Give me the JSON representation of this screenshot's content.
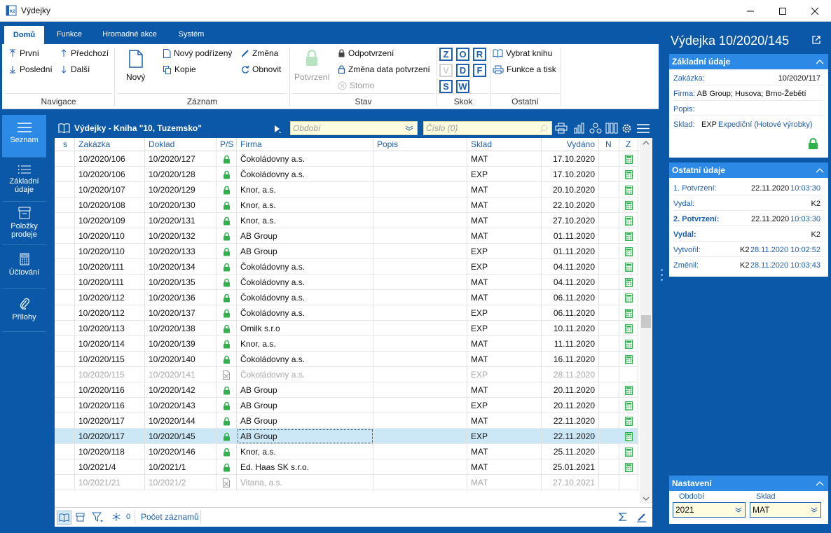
{
  "window": {
    "title": "Výdejky"
  },
  "ribbon": {
    "tabs": [
      "Domů",
      "Funkce",
      "Hromadné akce",
      "Systém"
    ],
    "nav": {
      "first": "První",
      "prev": "Předchozí",
      "last": "Poslední",
      "next": "Další",
      "group": "Navigace"
    },
    "record": {
      "new": "Nový",
      "new_child": "Nový podřízený",
      "change": "Změna",
      "copy": "Kopie",
      "refresh": "Obnovit",
      "group": "Záznam"
    },
    "state": {
      "confirm": "Potvrzení",
      "unconfirm": "Odpotvrzení",
      "change_date": "Změna data potvrzení",
      "storno": "Storno",
      "group": "Stav"
    },
    "jump": {
      "keys": [
        "Z",
        "O",
        "R",
        "V",
        "D",
        "F",
        "S",
        "W"
      ],
      "group": "Skok"
    },
    "other": {
      "select_book": "Vybrat knihu",
      "functions_print": "Funkce a tisk",
      "group": "Ostatní"
    }
  },
  "leftnav": [
    "Seznam",
    "Základní údaje",
    "Položky prodeje",
    "Účtování",
    "Přílohy"
  ],
  "grid": {
    "title": "Výdejky - Kniha \"10, Tuzemsko\"",
    "filter_period_placeholder": "Období",
    "filter_number_placeholder": "Číslo (0)",
    "columns": [
      "s",
      "Zakázka",
      "Doklad",
      "P/S",
      "Firma",
      "Popis",
      "Sklad",
      "Vydáno",
      "N",
      "Z"
    ],
    "rows": [
      {
        "zakazka": "10/2020/106",
        "doklad": "10/2020/127",
        "firma": "Čokoládovny a.s.",
        "sklad": "MAT",
        "vydano": "17.10.2020",
        "state": "locked"
      },
      {
        "zakazka": "10/2020/106",
        "doklad": "10/2020/128",
        "firma": "Čokoládovny a.s.",
        "sklad": "EXP",
        "vydano": "17.10.2020",
        "state": "locked"
      },
      {
        "zakazka": "10/2020/107",
        "doklad": "10/2020/129",
        "firma": "Knor, a.s.",
        "sklad": "MAT",
        "vydano": "20.10.2020",
        "state": "locked"
      },
      {
        "zakazka": "10/2020/108",
        "doklad": "10/2020/130",
        "firma": "Knor, a.s.",
        "sklad": "MAT",
        "vydano": "22.10.2020",
        "state": "locked"
      },
      {
        "zakazka": "10/2020/109",
        "doklad": "10/2020/131",
        "firma": "Knor, a.s.",
        "sklad": "MAT",
        "vydano": "27.10.2020",
        "state": "locked"
      },
      {
        "zakazka": "10/2020/110",
        "doklad": "10/2020/132",
        "firma": "AB Group",
        "sklad": "MAT",
        "vydano": "01.11.2020",
        "state": "locked"
      },
      {
        "zakazka": "10/2020/110",
        "doklad": "10/2020/133",
        "firma": "AB Group",
        "sklad": "EXP",
        "vydano": "01.11.2020",
        "state": "locked"
      },
      {
        "zakazka": "10/2020/111",
        "doklad": "10/2020/134",
        "firma": "Čokoládovny a.s.",
        "sklad": "EXP",
        "vydano": "04.11.2020",
        "state": "locked"
      },
      {
        "zakazka": "10/2020/111",
        "doklad": "10/2020/135",
        "firma": "Čokoládovny a.s.",
        "sklad": "MAT",
        "vydano": "04.11.2020",
        "state": "locked"
      },
      {
        "zakazka": "10/2020/112",
        "doklad": "10/2020/136",
        "firma": "Čokoládovny a.s.",
        "sklad": "MAT",
        "vydano": "06.11.2020",
        "state": "locked"
      },
      {
        "zakazka": "10/2020/112",
        "doklad": "10/2020/137",
        "firma": "Čokoládovny a.s.",
        "sklad": "EXP",
        "vydano": "06.11.2020",
        "state": "locked"
      },
      {
        "zakazka": "10/2020/113",
        "doklad": "10/2020/138",
        "firma": "Omilk s.r.o",
        "sklad": "EXP",
        "vydano": "10.11.2020",
        "state": "locked"
      },
      {
        "zakazka": "10/2020/114",
        "doklad": "10/2020/139",
        "firma": "Knor, a.s.",
        "sklad": "MAT",
        "vydano": "11.11.2020",
        "state": "locked"
      },
      {
        "zakazka": "10/2020/115",
        "doklad": "10/2020/140",
        "firma": "Čokoládovny a.s.",
        "sklad": "MAT",
        "vydano": "16.11.2020",
        "state": "locked"
      },
      {
        "zakazka": "10/2020/115",
        "doklad": "10/2020/141",
        "firma": "Čokoládovny a.s.",
        "sklad": "EXP",
        "vydano": "28.11.2020",
        "state": "storno"
      },
      {
        "zakazka": "10/2020/116",
        "doklad": "10/2020/142",
        "firma": "AB Group",
        "sklad": "MAT",
        "vydano": "20.11.2020",
        "state": "locked"
      },
      {
        "zakazka": "10/2020/116",
        "doklad": "10/2020/143",
        "firma": "AB Group",
        "sklad": "EXP",
        "vydano": "20.11.2020",
        "state": "locked"
      },
      {
        "zakazka": "10/2020/117",
        "doklad": "10/2020/144",
        "firma": "AB Group",
        "sklad": "MAT",
        "vydano": "22.11.2020",
        "state": "locked"
      },
      {
        "zakazka": "10/2020/117",
        "doklad": "10/2020/145",
        "firma": "AB Group",
        "sklad": "EXP",
        "vydano": "22.11.2020",
        "state": "locked",
        "selected": true
      },
      {
        "zakazka": "10/2020/118",
        "doklad": "10/2020/146",
        "firma": "Knor, a.s.",
        "sklad": "MAT",
        "vydano": "25.11.2020",
        "state": "locked"
      },
      {
        "zakazka": "10/2021/4",
        "doklad": "10/2021/1",
        "firma": "Ed. Haas SK s.r.o.",
        "sklad": "MAT",
        "vydano": "25.01.2021",
        "state": "locked"
      },
      {
        "zakazka": "10/2021/21",
        "doklad": "10/2021/2",
        "firma": "Vitana, a.s.",
        "sklad": "MAT",
        "vydano": "27.10.2021",
        "state": "storno"
      }
    ],
    "status": {
      "count": "0",
      "record_count": "Počet záznamů"
    }
  },
  "detail": {
    "title": "Výdejka 10/2020/145",
    "basic": {
      "header": "Základní údaje",
      "zakazka_label": "Zakázka:",
      "zakazka": "10/2020/117",
      "firma_label": "Firma:",
      "firma": "AB Group; Husova; Brno-Žebětí",
      "popis_label": "Popis:",
      "sklad_label": "Sklad:",
      "sklad_code": "EXP",
      "sklad_name": "Expediční (Hotové výrobky)"
    },
    "other": {
      "header": "Ostatní údaje",
      "conf1_label": "1. Potvrzení:",
      "conf1_date": "22.11.2020",
      "conf1_time": "10:03:30",
      "vydal1_label": "Vydal:",
      "vydal1": "K2",
      "conf2_label": "2. Potvrzení:",
      "conf2_date": "22.11.2020",
      "conf2_time": "10:03:30",
      "vydal2_label": "Vydal:",
      "vydal2": "K2",
      "created_label": "Vytvořil:",
      "created_user": "K2",
      "created_time": "28.11.2020 10:02:52",
      "changed_label": "Změnil:",
      "changed_user": "K2",
      "changed_time": "28.11.2020 10:03:43"
    },
    "settings": {
      "header": "Nastavení",
      "period_label": "Období",
      "period": "2021",
      "sklad_label": "Sklad",
      "sklad": "MAT"
    }
  },
  "colors": {
    "brand": "#0a58a7",
    "accent": "#2c8ae6",
    "lock": "#2fb24c",
    "selected": "#cce8f7"
  }
}
